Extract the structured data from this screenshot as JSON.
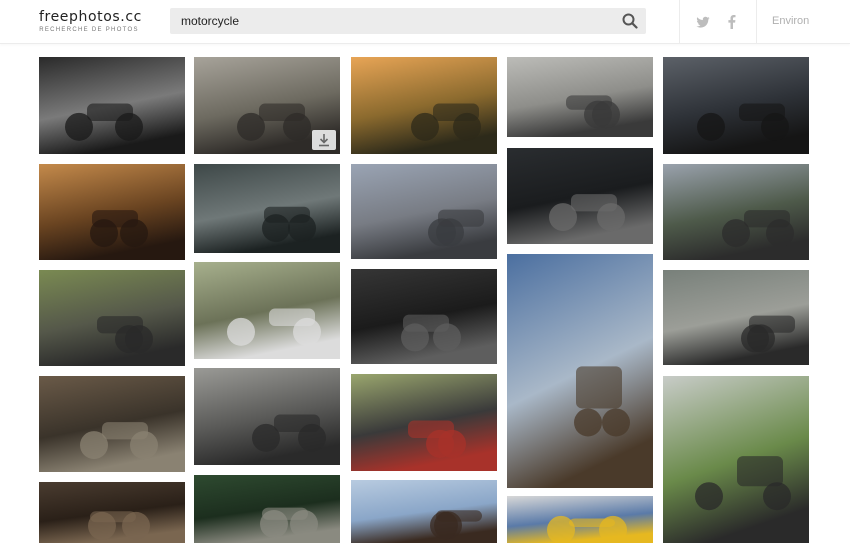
{
  "header": {
    "logo_name": "freephotos.cc",
    "logo_tagline": "RECHERCHE DE PHOTOS",
    "search_value": "motorcycle",
    "twitter_icon": "twitter-icon",
    "facebook_icon": "facebook-icon",
    "about_label": "Environ"
  },
  "colors": {
    "search_bg": "#ececec",
    "muted_text": "#b0b0b0"
  },
  "photos": [
    {
      "id": "p1",
      "scene": "rider on motorcycle in dark tree tunnel road",
      "colors": [
        "#2a2a2a",
        "#7a7a7a",
        "#1a1a1a"
      ]
    },
    {
      "id": "p2",
      "scene": "motorcyclist on hill at dusk",
      "colors": [
        "#a7a39a",
        "#6d6a60",
        "#2e2b28"
      ],
      "download": true
    },
    {
      "id": "p3",
      "scene": "motorcycle silhouette at sunset in field",
      "colors": [
        "#e8a556",
        "#8b6a2e",
        "#2d2a1a"
      ]
    },
    {
      "id": "p4",
      "scene": "vintage motorcycle by grey wall",
      "colors": [
        "#bcbcb8",
        "#8e8e8a",
        "#3a3a3a"
      ]
    },
    {
      "id": "p5",
      "scene": "rider in helmet close-up",
      "colors": [
        "#5c6168",
        "#2e3238",
        "#151515"
      ]
    },
    {
      "id": "p6",
      "scene": "cruiser motorcycle in warm sunset street",
      "colors": [
        "#c48a4b",
        "#6a4421",
        "#261810"
      ]
    },
    {
      "id": "p7",
      "scene": "engine close-up",
      "colors": [
        "#3e4848",
        "#6f7878",
        "#1c2222"
      ]
    },
    {
      "id": "p8",
      "scene": "rider on empty beach road",
      "colors": [
        "#9aa4b4",
        "#787c84",
        "#3a3c40"
      ]
    },
    {
      "id": "p9",
      "scene": "cafe racer in dark studio",
      "colors": [
        "#2a2d30",
        "#1a1c1e",
        "#6a6a6a"
      ]
    },
    {
      "id": "p10",
      "scene": "man with motorcycle mountains behind",
      "colors": [
        "#9aa2ad",
        "#4e5a4a",
        "#2c2c2c"
      ]
    },
    {
      "id": "p11",
      "scene": "sport bike parked on tree-lined street",
      "colors": [
        "#7a8a52",
        "#55584a",
        "#2a2a2a"
      ]
    },
    {
      "id": "p12",
      "scene": "white sport bike parked by trees",
      "colors": [
        "#a7b08d",
        "#6c7258",
        "#dcdcdc"
      ]
    },
    {
      "id": "p13",
      "scene": "dark chopper close-up",
      "colors": [
        "#363636",
        "#1b1b1b",
        "#5e5e5e"
      ]
    },
    {
      "id": "p14",
      "scene": "two motocross riders kissing at sunset",
      "colors": [
        "#4b6fa0",
        "#a9b8c8",
        "#4a3a2a"
      ]
    },
    {
      "id": "p15",
      "scene": "racing motorcycle leaning on track",
      "colors": [
        "#78807a",
        "#9c9e98",
        "#2a2a2a"
      ]
    },
    {
      "id": "p16",
      "scene": "motorcycle in narrow old street",
      "colors": [
        "#6a5a48",
        "#3a332a",
        "#8a8272"
      ]
    },
    {
      "id": "p17",
      "scene": "classic motorcycle parked in street",
      "colors": [
        "#9a9a96",
        "#5a5a58",
        "#2a2a2a"
      ]
    },
    {
      "id": "p18",
      "scene": "man in suit on red motorcycle",
      "colors": [
        "#9aa66e",
        "#3a3a3a",
        "#a8322a"
      ]
    },
    {
      "id": "p19",
      "scene": "cafe racer on green hill under cloudy sky",
      "colors": [
        "#c8ccc8",
        "#6a8a4a",
        "#2a2a2a"
      ]
    },
    {
      "id": "p20",
      "scene": "bikes in dark garage",
      "colors": [
        "#4a3c30",
        "#2a2018",
        "#7a6650"
      ]
    },
    {
      "id": "p21",
      "scene": "winding road aerial",
      "colors": [
        "#2e4a30",
        "#1c2e1e",
        "#8a8a80"
      ]
    },
    {
      "id": "p22",
      "scene": "motocross jump in sky",
      "colors": [
        "#b8cbe0",
        "#8aa6c8",
        "#3a2a20"
      ]
    },
    {
      "id": "p23",
      "scene": "yellow motorcycle by blue building",
      "colors": [
        "#d8d8d8",
        "#5a7aa8",
        "#e6b820"
      ]
    }
  ]
}
